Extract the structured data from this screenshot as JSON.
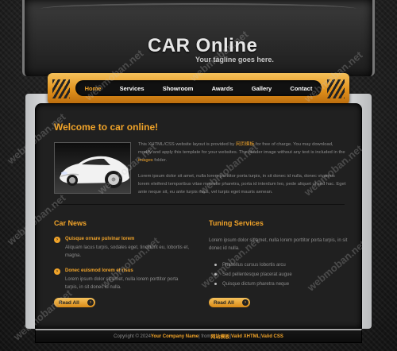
{
  "header": {
    "title": "CAR Online",
    "tagline": "Your tagline goes here."
  },
  "nav": {
    "items": [
      {
        "label": "Home",
        "active": true
      },
      {
        "label": "Services",
        "active": false
      },
      {
        "label": "Showroom",
        "active": false
      },
      {
        "label": "Awards",
        "active": false
      },
      {
        "label": "Gallery",
        "active": false
      },
      {
        "label": "Contact",
        "active": false
      }
    ]
  },
  "welcome": {
    "title": "Welcome to car online!",
    "intro_a": "This XHTML/CSS website layout is provided by ",
    "intro_link": "网页模板",
    "intro_b": " for free of charge. You may download, modify and apply this template for your websites. The header image without any text is included in the ",
    "intro_images": "images",
    "intro_c": " folder.",
    "para2": "Lorem ipsum dolor sit amet, nulla lorem porttitor porta turpis, in sit donec id nulla, donec vivamus lorem eleifend temporibus vitae molestie pharetra, porta id interdum leo, pede aliquet ut sed hac. Eget ante neque sit, eu ante turpis risus, vel turpis eget mauris aenean."
  },
  "car_news": {
    "title": "Car News",
    "items": [
      {
        "title": "Quisque ornare pulvinar lorem",
        "body": "Aliquam lacus turpis, sodales eget, tincidunt eu, lobortis et, magna."
      },
      {
        "title": "Donec euismod lorem et risus",
        "body": "Lorem ipsum dolor sit amet, nulla lorem porttitor porta turpis, in sit donec id nulla."
      }
    ],
    "button": "Read All"
  },
  "tuning": {
    "title": "Tuning Services",
    "text": "Lorem ipsum dolor sit amet, nulla lorem porttitor porta turpis, in sit donec id nulla.",
    "list": [
      "Phasellus cursus lobortis arcu",
      "Sed pellentesque placerat augue",
      "Quisque dictum pharetra neque"
    ],
    "button": "Read All"
  },
  "footer": {
    "copyright": "Copyright © 2024 ",
    "company": "Your Company Name",
    "sep1": " | from ",
    "from_link": "网站模板",
    "sep2": " | ",
    "xhtml": "Valid XHTML",
    "sep3": " | ",
    "css": "Valid CSS"
  },
  "watermark": {
    "text": "webmoban.net"
  },
  "colors": {
    "accent": "#f0a329",
    "content_bg": "#202020",
    "text": "#8d8d8d"
  }
}
